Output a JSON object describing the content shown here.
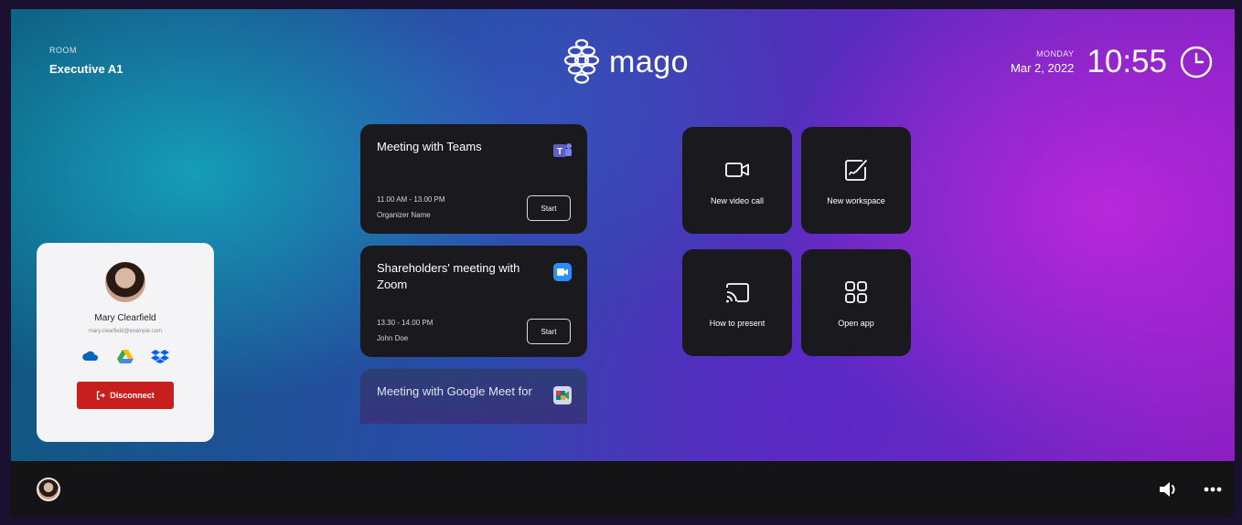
{
  "header": {
    "room_label": "ROOM",
    "room_name": "Executive A1",
    "brand": "mago",
    "weekday": "MONDAY",
    "date": "Mar 2, 2022",
    "time": "10:55"
  },
  "meetings": [
    {
      "title": "Meeting with Teams",
      "app_icon": "microsoft-teams-icon",
      "time": "11.00 AM - 13.00 PM",
      "organizer": "Organizer Name",
      "start_label": "Start",
      "app_color": "#5b5fc7"
    },
    {
      "title": "Shareholders' meeting with Zoom",
      "app_icon": "zoom-icon",
      "time": "13.30 - 14.00 PM",
      "organizer": "John Doe",
      "start_label": "Start",
      "app_color": "#2d8cff"
    },
    {
      "title": "Meeting with Google Meet for",
      "app_icon": "google-meet-icon",
      "app_color": "#00897b"
    }
  ],
  "actions": [
    {
      "label": "New video call",
      "icon": "video-camera-icon"
    },
    {
      "label": "New workspace",
      "icon": "workspace-edit-icon"
    },
    {
      "label": "How to present",
      "icon": "cast-icon"
    },
    {
      "label": "Open app",
      "icon": "app-grid-icon"
    }
  ],
  "user": {
    "name": "Mary Clearfield",
    "email": "mary.clearfield@example.com",
    "clouds": [
      "onedrive-icon",
      "google-drive-icon",
      "dropbox-icon"
    ],
    "disconnect_label": "Disconnect"
  },
  "colors": {
    "disconnect": "#c81e1e",
    "card_bg": "#1a1a1e",
    "bar_bg": "#141416"
  }
}
